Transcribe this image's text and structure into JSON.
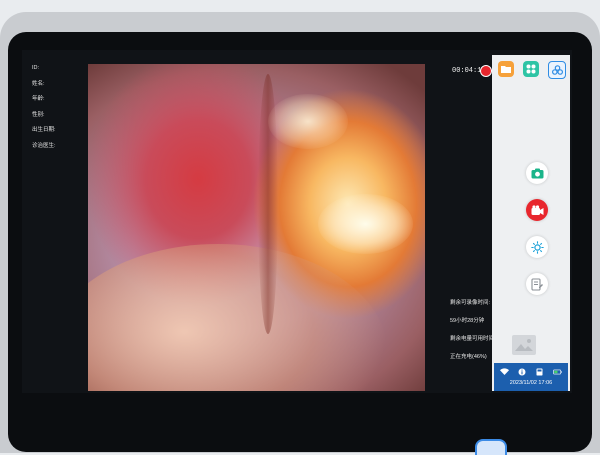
{
  "patient_info": {
    "id_label": "ID:",
    "name_label": "姓名:",
    "age_label": "年龄:",
    "sex_label": "性别:",
    "birthdate_label": "出生日期:",
    "doctor_label": "诊治医生:"
  },
  "recording": {
    "elapsed": "00:04:13",
    "indicator_color": "#e8262d"
  },
  "status_info": {
    "storage_time_label": "剩余可录像时间:",
    "storage_time_value": "59小时28分钟",
    "battery_time_label": "剩余电量可用时间:",
    "charging_label": "正在充电(46%)"
  },
  "side_panel": {
    "apps": [
      {
        "name": "folder",
        "color": "#f6a13a"
      },
      {
        "name": "apps-grid",
        "color": "#2ec4a5"
      },
      {
        "name": "network",
        "color": "#2f8de4"
      }
    ],
    "tools": [
      {
        "name": "camera",
        "color": "#1bb58a"
      },
      {
        "name": "video-record",
        "color": "#e8262d"
      },
      {
        "name": "brightness",
        "color": "#18a0d8"
      },
      {
        "name": "report",
        "color": "#8a8f95"
      }
    ]
  },
  "bottom_bar": {
    "datetime": "2023/11/02 17:06",
    "background": "#1c5fae"
  },
  "theme": {
    "accent": "#3c8be6",
    "record_red": "#e8262d"
  }
}
